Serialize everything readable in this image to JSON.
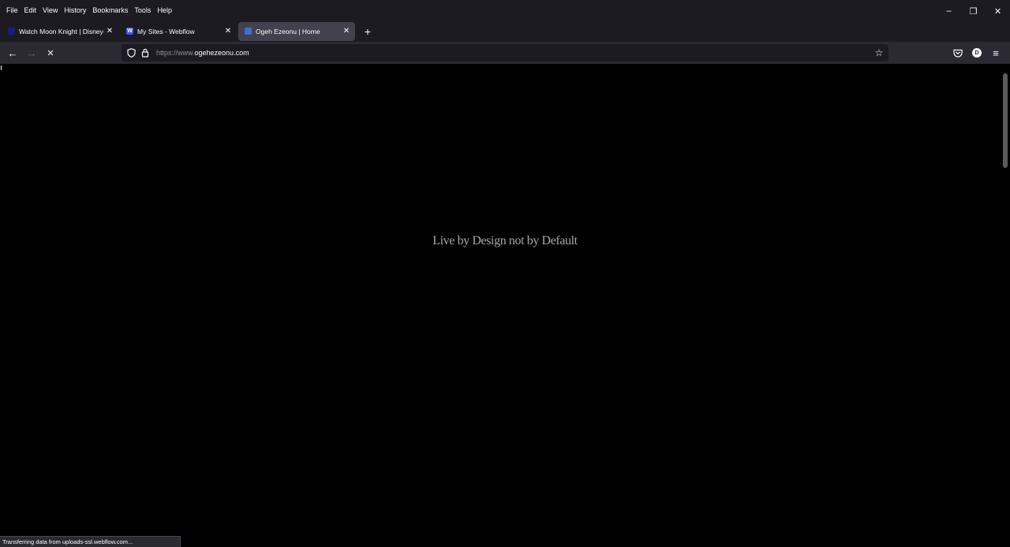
{
  "menu": {
    "items": [
      {
        "label": "File",
        "name": "menu-file"
      },
      {
        "label": "Edit",
        "name": "menu-edit"
      },
      {
        "label": "View",
        "name": "menu-view"
      },
      {
        "label": "History",
        "name": "menu-history"
      },
      {
        "label": "Bookmarks",
        "name": "menu-bookmarks"
      },
      {
        "label": "Tools",
        "name": "menu-tools"
      },
      {
        "label": "Help",
        "name": "menu-help"
      }
    ]
  },
  "window_controls": {
    "minimize": "–",
    "restore": "❐",
    "close": "✕"
  },
  "tabs": [
    {
      "title": "Watch Moon Knight | Disney+",
      "favicon_color": "#1a1a8c",
      "favicon_text": "",
      "active": false
    },
    {
      "title": "My Sites - Webflow",
      "favicon_color": "#4353ff",
      "favicon_text": "W",
      "active": false
    },
    {
      "title": "Ogeh Ezeonu | Home",
      "favicon_color": "#3a6fd8",
      "favicon_text": "",
      "active": true
    }
  ],
  "tab_close_glyph": "✕",
  "newtab_glyph": "+",
  "nav": {
    "back": "←",
    "forward": "→",
    "stop": "✕",
    "url_prefix": "https://www.",
    "url_domain": "ogehezeonu.com",
    "star": "☆",
    "menu_glyph": "≡",
    "avatar_letter": "D"
  },
  "page": {
    "tagline": "Live by Design not by Default"
  },
  "status": {
    "text": "Transferring data from uploads-ssl.webflow.com..."
  },
  "colors": {
    "chrome_bg": "#1c1b22",
    "toolbar_bg": "#2b2a33",
    "active_tab": "#42414d",
    "page_bg": "#000000"
  }
}
